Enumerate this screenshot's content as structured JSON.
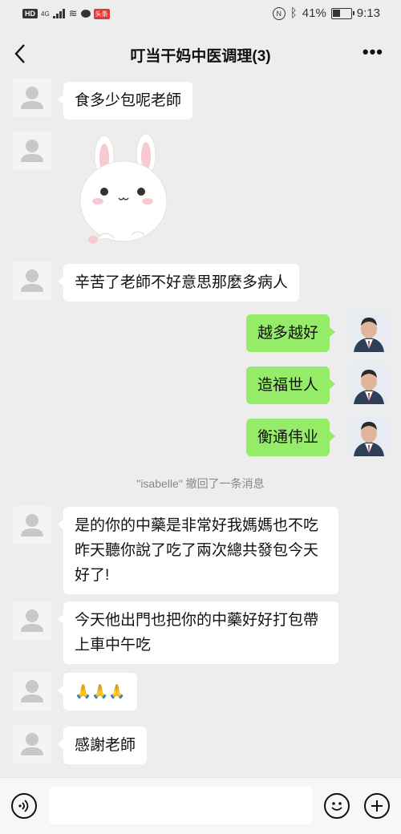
{
  "status_bar": {
    "left_badge": "HD",
    "network": "4G",
    "news_badge": "头条",
    "battery_percent": "41%",
    "battery_level": 0.41,
    "time": "9:13"
  },
  "header": {
    "title": "叮当干妈中医调理(3)",
    "more": "•••"
  },
  "messages": [
    {
      "side": "left",
      "text": "食多少包呢老師"
    },
    {
      "side": "left",
      "sticker": "rabbit-sticker"
    },
    {
      "side": "left",
      "text": "辛苦了老師不好意思那麼多病人"
    },
    {
      "side": "right",
      "text": "越多越好"
    },
    {
      "side": "right",
      "text": "造福世人"
    },
    {
      "side": "right",
      "text": "衡通伟业"
    },
    {
      "side": "left",
      "text": "是的你的中藥是非常好我媽媽也不吃昨天聽你說了吃了兩次總共發包今天好了!"
    },
    {
      "side": "left",
      "text": "今天他出門也把你的中藥好好打包帶上車中午吃"
    },
    {
      "side": "left",
      "text": "🙏🙏🙏"
    },
    {
      "side": "left",
      "text": "感謝老師"
    }
  ],
  "system_notice": "\"isabelle\" 撤回了一条消息",
  "bottom_bar": {
    "voice_icon": "voice-icon",
    "emoji_icon": "emoji-icon",
    "plus_icon": "plus-icon",
    "input_value": ""
  }
}
